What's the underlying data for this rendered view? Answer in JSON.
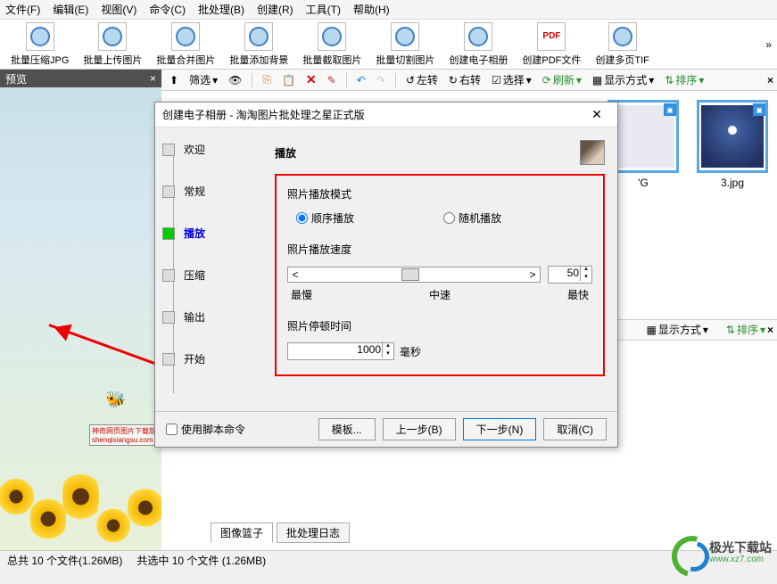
{
  "menu": {
    "file": "文件(F)",
    "edit": "编辑(E)",
    "view": "视图(V)",
    "cmd": "命令(C)",
    "batch": "批处理(B)",
    "create": "创建(R)",
    "tools": "工具(T)",
    "help": "帮助(H)"
  },
  "toolbar": {
    "items": [
      {
        "label": "批量压缩JPG"
      },
      {
        "label": "批量上传图片"
      },
      {
        "label": "批量合并图片"
      },
      {
        "label": "批量添加背景"
      },
      {
        "label": "批量截取图片"
      },
      {
        "label": "批量切割图片"
      },
      {
        "label": "创建电子相册"
      },
      {
        "label": "创建PDF文件",
        "pdf": "PDF"
      },
      {
        "label": "创建多页TIF"
      }
    ]
  },
  "preview": {
    "title": "预览",
    "watermark": "神奇网页图片下载版\nshenqixiangsu.com"
  },
  "toolbar2": {
    "nav_up": "↑",
    "nav_down": "↓",
    "filter": "筛选",
    "left": "左转",
    "right": "右转",
    "select": "选择",
    "refresh": "刷新",
    "display": "显示方式",
    "sort": "排序"
  },
  "thumbs": [
    {
      "name": "'G"
    },
    {
      "name": "3.jpg"
    }
  ],
  "dialog": {
    "title": "创建电子相册 - 淘淘图片批处理之星正式版",
    "steps": [
      {
        "label": "欢迎"
      },
      {
        "label": "常规"
      },
      {
        "label": "播放",
        "active": true
      },
      {
        "label": "压缩"
      },
      {
        "label": "输出"
      },
      {
        "label": "开始"
      }
    ],
    "main_title": "播放",
    "mode_label": "照片播放模式",
    "mode_seq": "顺序播放",
    "mode_rand": "随机播放",
    "speed_label": "照片播放速度",
    "speed_value": "50",
    "speed_slow": "最慢",
    "speed_mid": "中速",
    "speed_fast": "最快",
    "pause_label": "照片停顿时间",
    "pause_value": "1000",
    "pause_unit": "毫秒",
    "use_script": "使用脚本命令",
    "btn_template": "模板...",
    "btn_prev": "上一步(B)",
    "btn_next": "下一步(N)",
    "btn_cancel": "取消(C)"
  },
  "secondbar": {
    "display": "显示方式",
    "sort": "排序"
  },
  "tabs_bottom": {
    "basket": "图像篮子",
    "log": "批处理日志"
  },
  "status": {
    "total": "总共 10 个文件(1.26MB)",
    "selected": "共选中 10 个文件 (1.26MB)"
  },
  "brand": {
    "name": "极光下载站",
    "url": "www.xz7.com"
  }
}
